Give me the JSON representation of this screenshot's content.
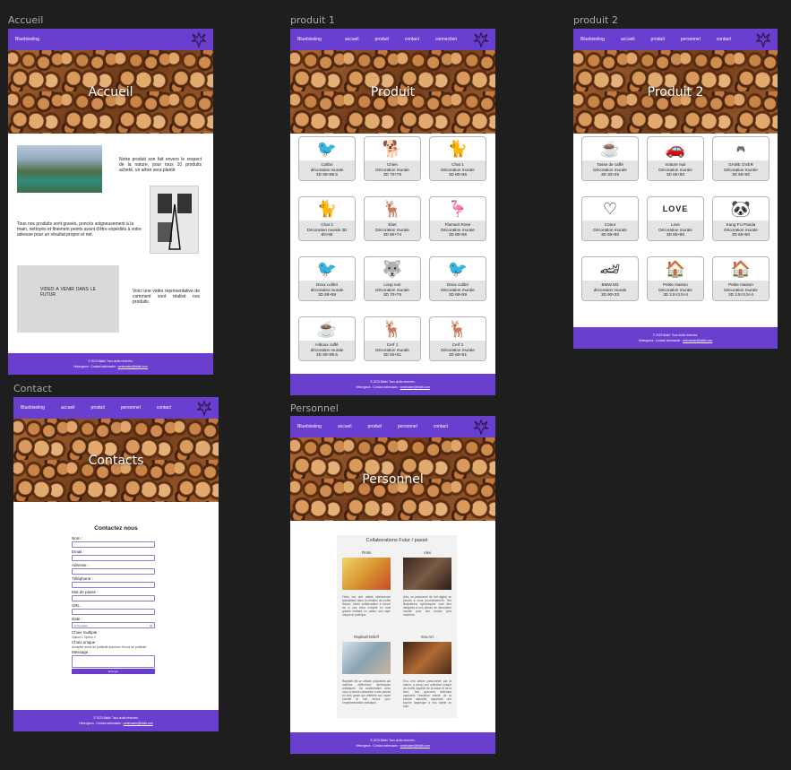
{
  "frames": {
    "accueil": "Accueil",
    "produit1": "produit 1",
    "produit2": "produit 2",
    "contact": "Contact",
    "personnel": "Personnel"
  },
  "brand": "Bluebixeling",
  "nav": {
    "accueil": "accueil",
    "produit": "produit",
    "contact": "contact",
    "connection": "connection",
    "personnel": "personnel"
  },
  "footer": {
    "line1": "© 2023 Blaibi. Tous droits réservés.",
    "line2": "Hébergeurs : Contact webmaster :",
    "email": "webmaster@blaibi.com"
  },
  "accueil": {
    "hero": "Accueil",
    "text1": "Notre produit son fait envers le respect de la nature, pour tous 10 produits acheté, un arbre sera planté",
    "text2": "Tous nos produits sont gravés, poncés soigneusement à la main, nettoyés et finement peints avant d'être expédiés à votre adresse pour un résultat propre et net.",
    "video": "VIDEO A VENIR DANS LE FUTUR",
    "text3": "Voici une vidéo représentative de comment sont réalisé nos produits"
  },
  "produit1": {
    "hero": "Produit",
    "items": [
      {
        "icon": "🐦",
        "name": "Colibri",
        "l2": "décoration murale",
        "l3": "3D 80×89.5"
      },
      {
        "icon": "🐕",
        "name": "Chien",
        "l2": "Décoration murale",
        "l3": "3D 70×76"
      },
      {
        "icon": "🐈",
        "name": "Chat 1",
        "l2": "Décoration murale",
        "l3": "3D 80×65"
      },
      {
        "icon": "🐈",
        "name": "Chat 2",
        "l2": "Décoration murale  3D",
        "l3": "80×65"
      },
      {
        "icon": "🦌",
        "name": "Elan",
        "l2": "Décoration murale",
        "l3": "3D 80×74"
      },
      {
        "icon": "🦩",
        "name": "Flamant Rose",
        "l2": "Décoration murale",
        "l3": "3D 80×65"
      },
      {
        "icon": "🐦",
        "name": "Deux colibri",
        "l2": "décoration murale",
        "l3": "3D 69×59"
      },
      {
        "icon": "🐺",
        "name": "Loup noir",
        "l2": "Décoration murale",
        "l3": "3D 70×76"
      },
      {
        "icon": "🐦",
        "name": "Deux colibri",
        "l2": "Décoration murale",
        "l3": "3D 69×59"
      },
      {
        "icon": "☕",
        "name": "Hiboux caffé",
        "l2": "décoration murale",
        "l3": "3D 80×89.5"
      },
      {
        "icon": "🦌",
        "name": "Cerf 1",
        "l2": "Décoration murale",
        "l3": "3D 60×61"
      },
      {
        "icon": "🦌",
        "name": "Cerf 2",
        "l2": "Décoration murale",
        "l3": "3D 60×61"
      }
    ]
  },
  "produit2": {
    "hero": "Produit 2",
    "items": [
      {
        "icon": "☕",
        "name": "Tasse de caffé",
        "l2": "Décoration murale",
        "l3": "3D 30×25"
      },
      {
        "icon": "🚗",
        "name": "Voiture noir",
        "l2": "Décoration murale",
        "l3": "3D 65×80"
      },
      {
        "icon": "🎮",
        "name": "GAME OVER",
        "l2": "Décoration murale",
        "l3": "3D 65×80"
      },
      {
        "icon": "♡",
        "name": "Coeur",
        "l2": "Décoration murale",
        "l3": "3D 65×80"
      },
      {
        "icon": "LOVE",
        "name": "Love",
        "l2": "Décoration murale",
        "l3": "3D 65×80"
      },
      {
        "icon": "🐼",
        "name": "Kung FU Panda",
        "l2": "Décoration murale",
        "l3": "3D 65×80"
      },
      {
        "icon": "🏎",
        "name": "BMW M3",
        "l2": "décoration murale",
        "l3": "3D 90×33"
      },
      {
        "icon": "🏠",
        "name": "Petite maison",
        "l2": "Décoration murale",
        "l3": "3D 3.5×3.5×4"
      },
      {
        "icon": "🏠",
        "name": "Petite maison",
        "l2": "Décoration murale",
        "l3": "3D 3.5×3.5×4"
      }
    ]
  },
  "contact": {
    "hero": "Contacts",
    "title": "Contactez nous",
    "nom": "Nom :",
    "email": "Email :",
    "adresse": "Adresse :",
    "telephone": "Téléphone :",
    "mdp": "Mot de passe :",
    "url": "URL :",
    "date": "Date :",
    "date_placeholder": "jj/mm/aaaa",
    "choix_multiple": "Choix multiple :",
    "options": "Option 1   Option 2",
    "choix_unique": "Choix unique :",
    "radio": "Accepter envoi de publicité   Autoriser l'envoi de publicité",
    "message": "Message :",
    "send": "Envoyer"
  },
  "personnel": {
    "hero": "Personnel",
    "collab_title": "Collaborations Futur / passé",
    "people": [
      {
        "name": "Floris",
        "text": "Floris est une artiste talentueuse spécialisée dans la création de motifs floraux. Notre collaboration a donné vie à une série d'objets en bois gravés mettant en valeur son style unique et poétique."
      },
      {
        "name": "Alex",
        "text": "Alex, un passionné de l'art digital, se joindra à nous prochainement. Ses illustrations dynamiques vont être intégrées à nos pièces de décoration murale pour une touche plus moderne."
      },
      {
        "name": "Raphaël Drilelf",
        "text": "Raphaël est un artisan polyvalent qui maîtrise différentes techniques artistiques. Sa collaboration avec nous a donné naissance à des pièces en bois gravé qui reflètent son esprit inventif et son amour pour l'expérimentation artistique."
      },
      {
        "name": "Eva Art",
        "text": "Eva, une artiste passionnée par la nature, a conçu une collection unique de motifs inspirés de la faune et de la flore. Ses gravures délicates capturent l'essence même de la beauté naturelle, apportant une touche organique à nos objets en bois."
      }
    ]
  },
  "colors": {
    "brand": "#6a3fd0",
    "canvas": "#1e1e1e",
    "caption": "#e4e4e4"
  }
}
